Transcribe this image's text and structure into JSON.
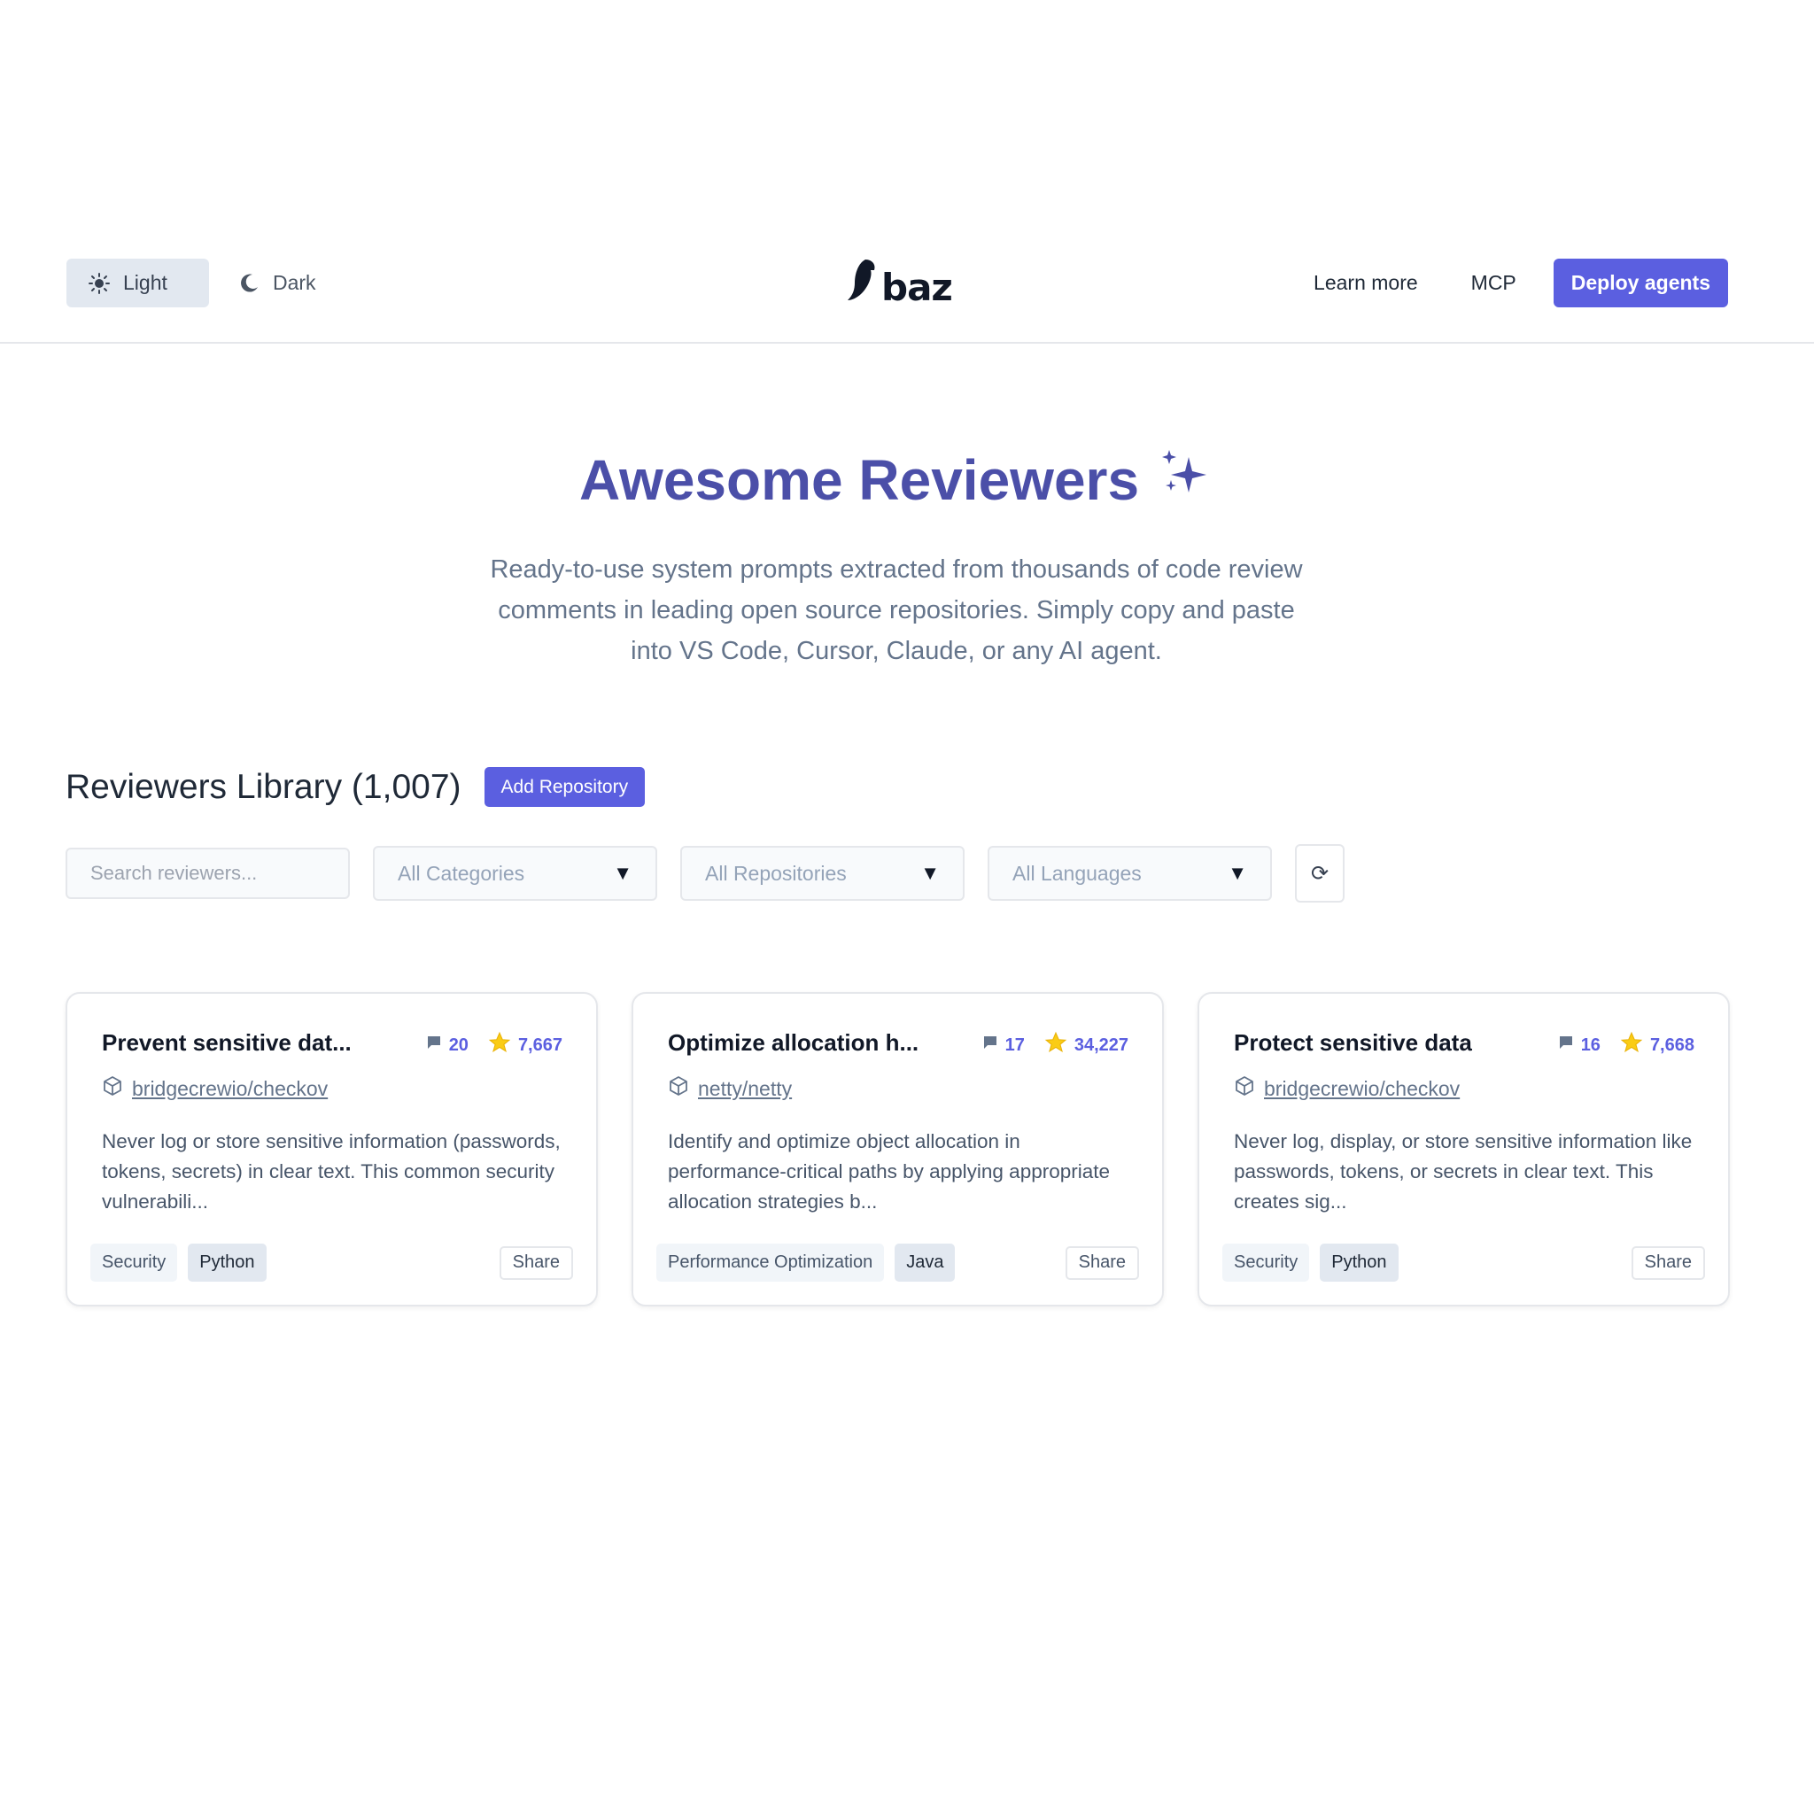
{
  "header": {
    "theme": {
      "light_label": "Light",
      "dark_label": "Dark"
    },
    "logo_text": "baz",
    "nav": {
      "learn_more": "Learn more",
      "mcp": "MCP",
      "deploy": "Deploy agents"
    }
  },
  "hero": {
    "title": "Awesome Reviewers",
    "subtitle": "Ready-to-use system prompts extracted from thousands of code review comments in leading open source repositories. Simply copy and paste into VS Code, Cursor, Claude, or any AI agent."
  },
  "library": {
    "title": "Reviewers Library (1,007)",
    "add_button": "Add Repository",
    "filters": {
      "search_placeholder": "Search reviewers...",
      "categories": "All Categories",
      "repositories": "All Repositories",
      "languages": "All Languages"
    }
  },
  "cards": [
    {
      "title": "Prevent sensitive dat...",
      "comments": "20",
      "stars": "7,667",
      "repo": "bridgecrewio/checkov",
      "description": "Never log or store sensitive information (passwords, tokens, secrets) in clear text. This common security vulnerabili...",
      "category": "Security",
      "language": "Python",
      "share": "Share"
    },
    {
      "title": "Optimize allocation h...",
      "comments": "17",
      "stars": "34,227",
      "repo": "netty/netty",
      "description": "Identify and optimize object allocation in performance-critical paths by applying appropriate allocation strategies b...",
      "category": "Performance Optimization",
      "language": "Java",
      "share": "Share"
    },
    {
      "title": "Protect sensitive data",
      "comments": "16",
      "stars": "7,668",
      "repo": "bridgecrewio/checkov",
      "description": "Never log, display, or store sensitive information like passwords, tokens, or secrets in clear text. This creates sig...",
      "category": "Security",
      "language": "Python",
      "share": "Share"
    }
  ],
  "colors": {
    "accent": "#5b5fe0",
    "hero_title": "#4b4fa8",
    "star": "#facc15"
  },
  "icons": {
    "light": "sun-icon",
    "dark": "moon-icon",
    "comments": "comment-icon",
    "stars": "star-icon",
    "repo": "package-icon",
    "refresh": "refresh-icon",
    "dropdown": "caret-down-icon",
    "sparkles": "sparkles-icon"
  }
}
